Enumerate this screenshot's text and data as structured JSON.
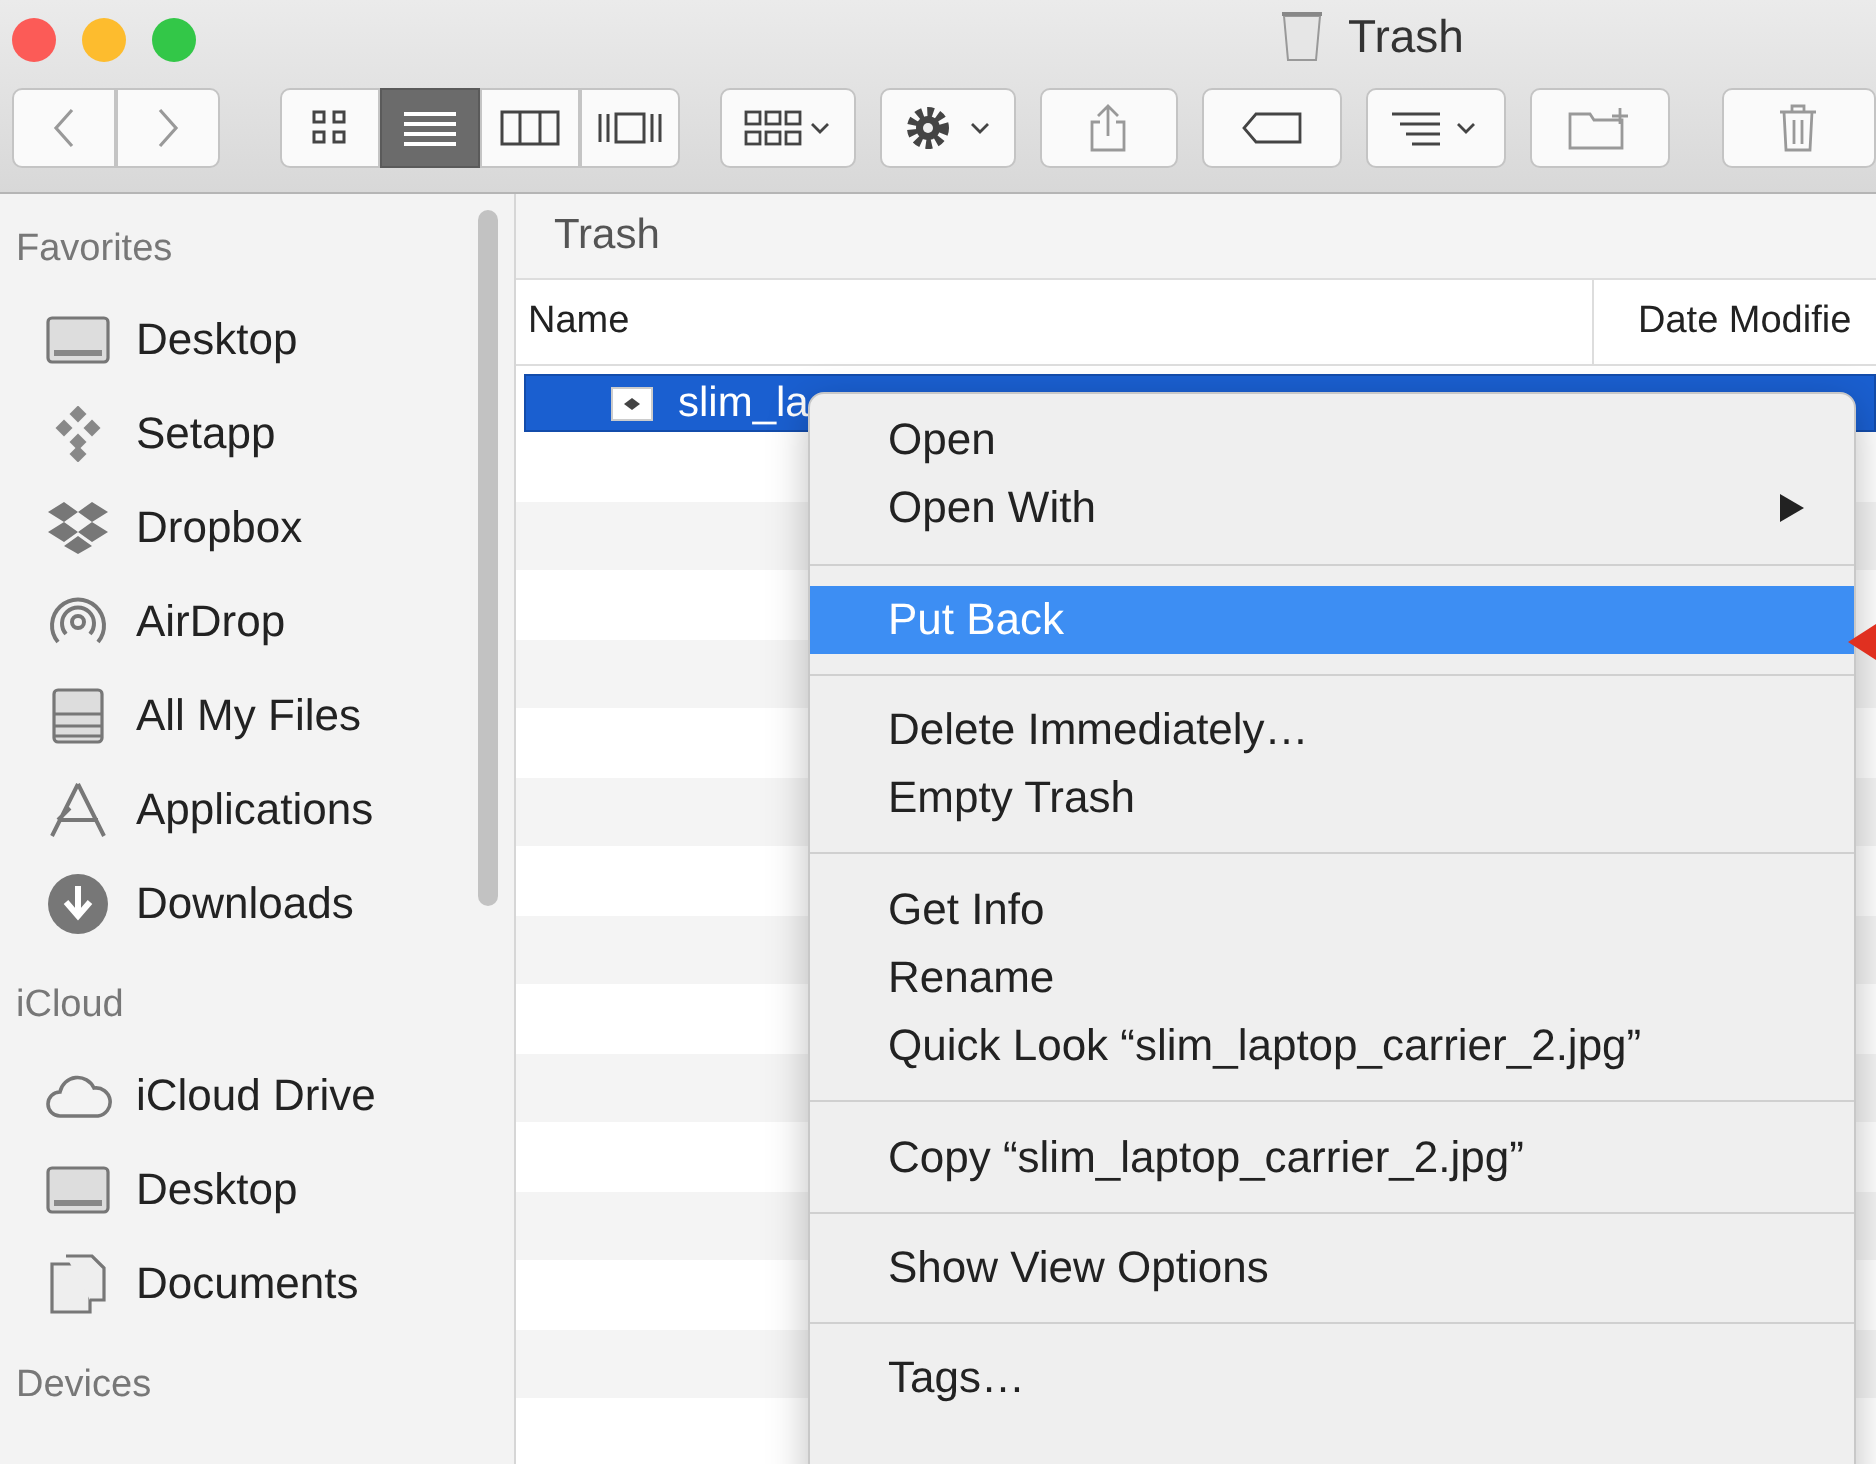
{
  "window": {
    "title": "Trash"
  },
  "toolbar": {
    "view_modes": [
      {
        "kind": "icons",
        "selected": false
      },
      {
        "kind": "list",
        "selected": true
      },
      {
        "kind": "columns",
        "selected": false
      },
      {
        "kind": "cover",
        "selected": false
      }
    ]
  },
  "sidebar": {
    "sections": [
      {
        "header": "Favorites",
        "items": [
          {
            "label": "Desktop",
            "kind": "desktop"
          },
          {
            "label": "Setapp",
            "kind": "setapp"
          },
          {
            "label": "Dropbox",
            "kind": "dropbox"
          },
          {
            "label": "AirDrop",
            "kind": "airdrop"
          },
          {
            "label": "All My Files",
            "kind": "files"
          },
          {
            "label": "Applications",
            "kind": "apps"
          },
          {
            "label": "Downloads",
            "kind": "downloads"
          }
        ]
      },
      {
        "header": "iCloud",
        "items": [
          {
            "label": "iCloud Drive",
            "kind": "cloud"
          },
          {
            "label": "Desktop",
            "kind": "desktop"
          },
          {
            "label": "Documents",
            "kind": "documents"
          }
        ]
      },
      {
        "header": "Devices"
      }
    ]
  },
  "browser": {
    "path": "Trash",
    "columns": [
      "Name",
      "Date Modifie"
    ],
    "rows": [
      {
        "name": "slim_la",
        "selected": true
      }
    ]
  },
  "context_menu": {
    "groups": [
      [
        {
          "label": "Open",
          "submenu": false,
          "selected": false
        },
        {
          "label": "Open With",
          "submenu": true,
          "selected": false
        }
      ],
      [
        {
          "label": "Put Back",
          "submenu": false,
          "selected": true
        }
      ],
      [
        {
          "label": "Delete Immediately…",
          "submenu": false,
          "selected": false
        },
        {
          "label": "Empty Trash",
          "submenu": false,
          "selected": false
        }
      ],
      [
        {
          "label": "Get Info",
          "submenu": false,
          "selected": false
        },
        {
          "label": "Rename",
          "submenu": false,
          "selected": false
        },
        {
          "label": "Quick Look “slim_laptop_carrier_2.jpg”",
          "submenu": false,
          "selected": false
        }
      ],
      [
        {
          "label": "Copy “slim_laptop_carrier_2.jpg”",
          "submenu": false,
          "selected": false
        }
      ],
      [
        {
          "label": "Show View Options",
          "submenu": false,
          "selected": false
        }
      ],
      [
        {
          "label": "Tags…",
          "submenu": false,
          "selected": false
        }
      ]
    ]
  }
}
